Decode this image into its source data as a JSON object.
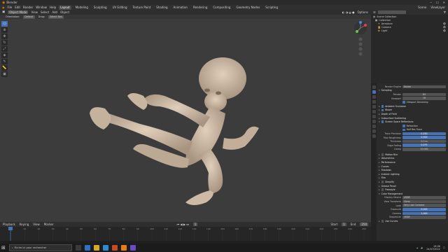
{
  "window": {
    "title": "Blender"
  },
  "menubar": {
    "menus": [
      "File",
      "Edit",
      "Render",
      "Window",
      "Help"
    ],
    "workspaces": [
      "Layout",
      "Modeling",
      "Sculpting",
      "UV Editing",
      "Texture Paint",
      "Shading",
      "Animation",
      "Rendering",
      "Compositing",
      "Geometry Nodes",
      "Scripting"
    ],
    "active_workspace": "Layout",
    "scene": "Scene",
    "view_layer": "ViewLayer"
  },
  "viewport_header": {
    "mode": "Object Mode",
    "menus": [
      "View",
      "Select",
      "Add",
      "Object"
    ],
    "orientation": "Orientation:",
    "orientation_value": "Default",
    "drag": "Drag:",
    "drag_value": "Select Box",
    "options": "Options"
  },
  "timeline": {
    "menus": [
      "Playback",
      "Keying",
      "View",
      "Marker"
    ],
    "start_label": "Start",
    "start": "1",
    "end_label": "End",
    "end": "250",
    "current": "1",
    "ticks": [
      "0",
      "10",
      "20",
      "30",
      "40",
      "50",
      "60",
      "70",
      "80",
      "90",
      "100",
      "110",
      "120",
      "130",
      "140",
      "150",
      "160",
      "170",
      "180",
      "190",
      "200",
      "210",
      "220",
      "230",
      "240",
      "250"
    ]
  },
  "outliner": {
    "title": "Scene Collection",
    "items": [
      {
        "name": "Collection",
        "icon": "collection-icon"
      },
      {
        "name": "Armature",
        "icon": "armature-icon"
      },
      {
        "name": "Camera",
        "icon": "camera-icon"
      },
      {
        "name": "Light",
        "icon": "light-icon"
      }
    ]
  },
  "properties": {
    "render_engine_label": "Render Engine",
    "render_engine": "Eevee",
    "sampling": {
      "title": "Sampling",
      "render_label": "Render",
      "render": "64",
      "viewport_label": "Viewport",
      "viewport": "16",
      "denoising": "Viewport Denoising"
    },
    "sections": [
      "Ambient Occlusion",
      "Bloom",
      "Depth of Field",
      "Subsurface Scattering",
      "Screen Space Reflections"
    ],
    "ssr": {
      "refraction": "Refraction",
      "half_res": "Half Res Trace",
      "fields": [
        {
          "label": "Trace Precision",
          "value": "0.250"
        },
        {
          "label": "Max Roughness",
          "value": "0.500"
        },
        {
          "label": "Thickness",
          "value": "0.2 m"
        },
        {
          "label": "Edge Fading",
          "value": "0.075"
        },
        {
          "label": "Clamp",
          "value": "10.000"
        }
      ]
    },
    "sections2": [
      "Motion Blur",
      "Volumetrics",
      "Performance",
      "Curves",
      "Shadows",
      "Indirect Lighting",
      "Film",
      "Simplify",
      "Grease Pencil",
      "Freestyle"
    ],
    "color_management": {
      "title": "Color Management",
      "fields": [
        {
          "label": "Display Device",
          "value": "sRGB"
        },
        {
          "label": "View Transform",
          "value": "Filmic"
        },
        {
          "label": "Look",
          "value": "Very Low Contrast"
        },
        {
          "label": "Exposure",
          "value": "0.000"
        },
        {
          "label": "Gamma",
          "value": "1.000"
        },
        {
          "label": "Sequencer",
          "value": "sRGB"
        }
      ],
      "use_curves": "Use Curves"
    }
  },
  "taskbar": {
    "search_placeholder": "Écrire ici pour rechercher",
    "time": "19:06",
    "date": "24/07/2022"
  },
  "colors": {
    "accent": "#4772b3",
    "viewport_bg": "#3c3c3c",
    "skin": "#d2c0ab"
  }
}
